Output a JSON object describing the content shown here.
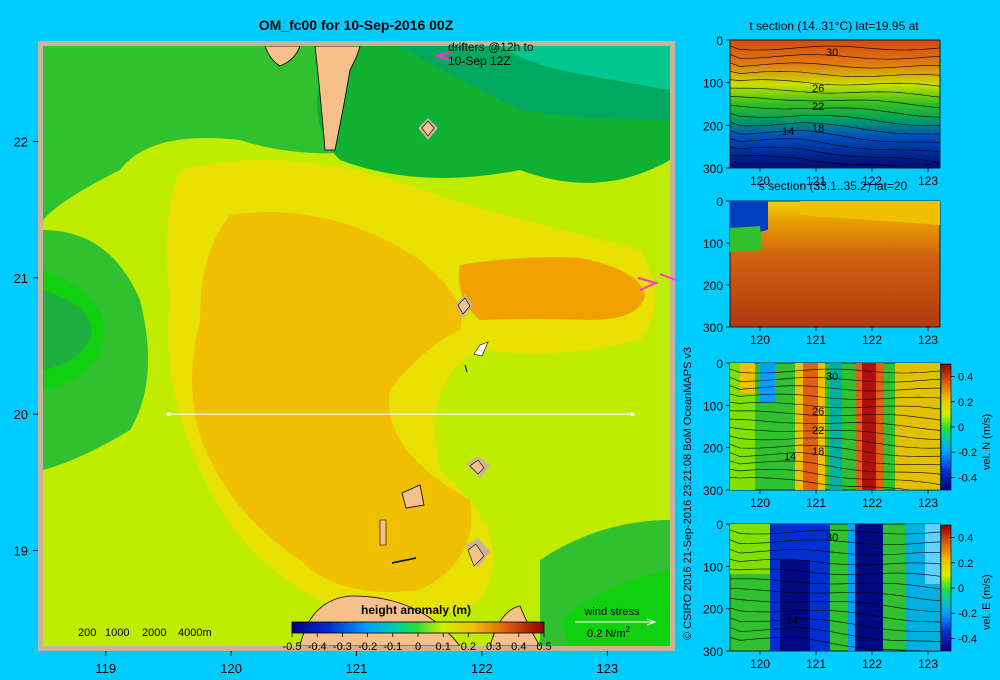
{
  "figure": {
    "title": "OM_fc00 for 10-Sep-2016 00Z",
    "drifters_label_line1": "drifters @12h to",
    "drifters_label_line2": "10-Sep 12Z",
    "copyright": "© CSIRO 2016   21-Sep-2016 23:21:08 BoM OceanMAPS v3",
    "depth_legend": [
      "200",
      "1000",
      "2000",
      "4000m"
    ],
    "wind_label": "wind stress",
    "wind_scale": "0.2 N/m",
    "wind_scale_sup": "2",
    "colors": {
      "background": "#00ccff",
      "frame": "#c8b49a",
      "land": "#f5c08a",
      "transect": "#ffffff",
      "drifter": "#ff33cc"
    }
  },
  "chart_data": [
    {
      "type": "heatmap",
      "name": "map",
      "xlim": [
        118.5,
        123.5
      ],
      "ylim": [
        18.3,
        22.7
      ],
      "x_ticks": [
        "119",
        "120",
        "121",
        "122",
        "123"
      ],
      "y_ticks": [
        "19",
        "20",
        "21",
        "22"
      ],
      "colorbar_title": "height anomaly  (m)",
      "colorbar_ticks": [
        "-0.5",
        "-0.4",
        "-0.3",
        "-0.2",
        "-0.1",
        "0",
        "0.1",
        "0.2",
        "0.3",
        "0.4",
        "0.5"
      ],
      "colorbar_range": [
        -0.5,
        0.5
      ],
      "transect": {
        "lat": 20.0,
        "lon": [
          119.5,
          123.2
        ]
      }
    },
    {
      "type": "heatmap",
      "name": "t-section",
      "title": "t section (14..31°C) lat=19.95 at",
      "x_ticks": [
        "120",
        "121",
        "122",
        "123"
      ],
      "y_ticks": [
        "0",
        "100",
        "200",
        "300"
      ],
      "contour_labels": [
        "30",
        "26",
        "22",
        "14",
        "18"
      ]
    },
    {
      "type": "heatmap",
      "name": "s-section",
      "title": "s section (33.1..35.2) lat=20",
      "x_ticks": [
        "120",
        "121",
        "122",
        "123"
      ],
      "y_ticks": [
        "0",
        "100",
        "200",
        "300"
      ]
    },
    {
      "type": "heatmap",
      "name": "vel-n",
      "x_ticks": [
        "120",
        "121",
        "122",
        "123"
      ],
      "y_ticks": [
        "0",
        "100",
        "200",
        "300"
      ],
      "contour_labels": [
        "30",
        "26",
        "22",
        "14",
        "18"
      ],
      "colorbar_label": "vel. N  (m/s)",
      "colorbar_ticks": [
        "0.4",
        "0.2",
        "0",
        "-0.2",
        "-0.4"
      ]
    },
    {
      "type": "heatmap",
      "name": "vel-e",
      "x_ticks": [
        "120",
        "121",
        "122",
        "123"
      ],
      "y_ticks": [
        "0",
        "100",
        "200",
        "300"
      ],
      "contour_labels": [
        "30",
        "14"
      ],
      "colorbar_label": "vel. E  (m/s)",
      "colorbar_ticks": [
        "0.4",
        "0.2",
        "0",
        "-0.2",
        "-0.4"
      ]
    }
  ]
}
